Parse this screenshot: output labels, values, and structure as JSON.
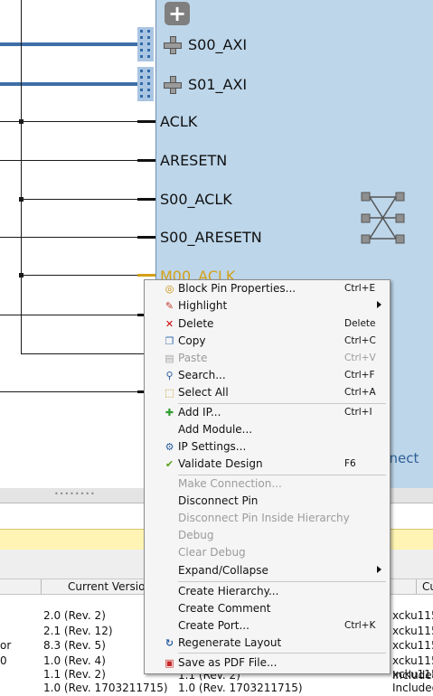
{
  "canvas": {
    "block_pins": [
      {
        "label": "S00_AXI",
        "kind": "bus"
      },
      {
        "label": "S01_AXI",
        "kind": "bus"
      },
      {
        "label": "ACLK",
        "kind": "wire"
      },
      {
        "label": "ARESETN",
        "kind": "wire"
      },
      {
        "label": "S00_ACLK",
        "kind": "wire"
      },
      {
        "label": "S00_ARESETN",
        "kind": "wire"
      },
      {
        "label": "M00_ACLK",
        "kind": "wire",
        "highlighted": true
      }
    ],
    "block_name_fragment": "nnect",
    "add_button_label": "+"
  },
  "bottom_panel": {
    "table_headers": [
      "Current Versio",
      "Cu"
    ],
    "rows": [
      {
        "c0": "",
        "c1": "2.0 (Rev. 2)",
        "c2": "",
        "c3": "xcku115"
      },
      {
        "c0": "",
        "c1": "2.1 (Rev. 12)",
        "c2": "",
        "c3": "xcku115"
      },
      {
        "c0": "or",
        "c1": "8.3 (Rev. 5)",
        "c2": "",
        "c3": "xcku115"
      },
      {
        "c0": "0",
        "c1": "1.0 (Rev. 4)",
        "c2": "",
        "c3": "xcku115"
      },
      {
        "c0": "",
        "c1": "1.1 (Rev. 2)",
        "c2": "",
        "c3": "xcku115"
      },
      {
        "c0": "",
        "c1": "",
        "c2": "1.1 (Rev. 2)",
        "c3": "Included"
      },
      {
        "c0": "",
        "c1": "1.0 (Rev. 1703211715)",
        "c2": "1.0 (Rev. 1703211715)",
        "c3": "Included"
      }
    ]
  },
  "context_menu": {
    "items": [
      {
        "label": "Block Pin Properties...",
        "shortcut": "Ctrl+E",
        "icon": "properties-icon",
        "enabled": true
      },
      {
        "label": "Highlight",
        "shortcut": "",
        "icon": "highlight-icon",
        "enabled": true,
        "submenu": true
      },
      {
        "label": "Delete",
        "shortcut": "Delete",
        "icon": "delete-icon",
        "enabled": true
      },
      {
        "label": "Copy",
        "shortcut": "Ctrl+C",
        "icon": "copy-icon",
        "enabled": true
      },
      {
        "label": "Paste",
        "shortcut": "Ctrl+V",
        "icon": "paste-icon",
        "enabled": false
      },
      {
        "label": "Search...",
        "shortcut": "Ctrl+F",
        "icon": "search-icon",
        "enabled": true
      },
      {
        "label": "Select All",
        "shortcut": "Ctrl+A",
        "icon": "select-all-icon",
        "enabled": true
      },
      {
        "label": "Add IP...",
        "shortcut": "Ctrl+I",
        "icon": "add-ip-icon",
        "enabled": true
      },
      {
        "label": "Add Module...",
        "shortcut": "",
        "icon": "",
        "enabled": true
      },
      {
        "label": "IP Settings...",
        "shortcut": "",
        "icon": "ip-settings-icon",
        "enabled": true
      },
      {
        "label": "Validate Design",
        "shortcut": "F6",
        "icon": "validate-icon",
        "enabled": true
      },
      {
        "label": "Make Connection...",
        "shortcut": "",
        "icon": "",
        "enabled": false
      },
      {
        "label": "Disconnect Pin",
        "shortcut": "",
        "icon": "",
        "enabled": true
      },
      {
        "label": "Disconnect Pin Inside Hierarchy",
        "shortcut": "",
        "icon": "",
        "enabled": false
      },
      {
        "label": "Debug",
        "shortcut": "",
        "icon": "",
        "enabled": false
      },
      {
        "label": "Clear Debug",
        "shortcut": "",
        "icon": "",
        "enabled": false
      },
      {
        "label": "Expand/Collapse",
        "shortcut": "",
        "icon": "",
        "enabled": true,
        "submenu": true
      },
      {
        "label": "Create Hierarchy...",
        "shortcut": "",
        "icon": "",
        "enabled": true
      },
      {
        "label": "Create Comment",
        "shortcut": "",
        "icon": "",
        "enabled": true
      },
      {
        "label": "Create Port...",
        "shortcut": "Ctrl+K",
        "icon": "",
        "enabled": true
      },
      {
        "label": "Regenerate Layout",
        "shortcut": "",
        "icon": "regenerate-icon",
        "enabled": true
      },
      {
        "label": "Save as PDF File...",
        "shortcut": "",
        "icon": "pdf-icon",
        "enabled": true
      }
    ]
  },
  "colors": {
    "block_fill": "#bdd6ea",
    "bus_wire": "#3e6fa6",
    "highlight_pin": "#d4a017",
    "menu_bg": "#f5f5f5",
    "yellow_bar": "#fff4b3"
  }
}
